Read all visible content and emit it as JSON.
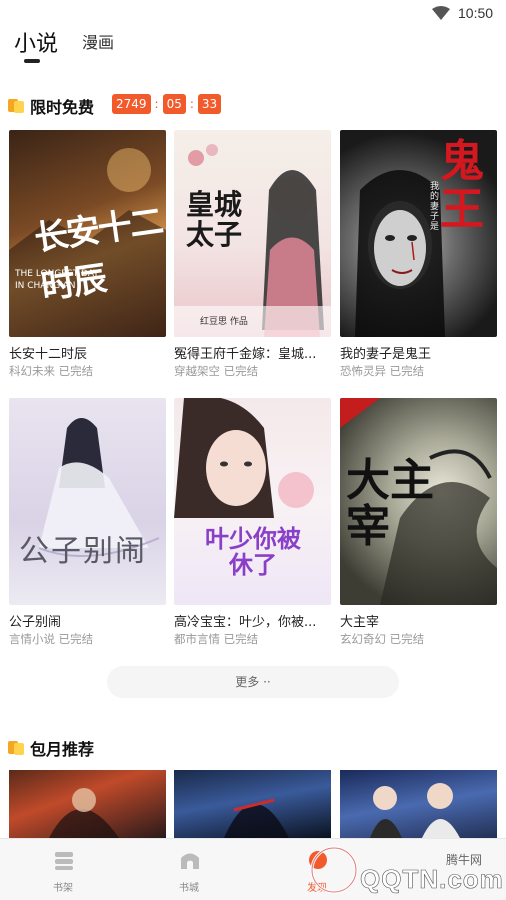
{
  "status_bar": {
    "time": "10:50"
  },
  "top_tabs": {
    "active": "小说",
    "inactive": "漫画"
  },
  "limited_free": {
    "title": "限时免费",
    "countdown": {
      "hours": "2749",
      "minutes": "05",
      "seconds": "33"
    },
    "books": [
      {
        "title": "长安十二时辰",
        "genre": "科幻未来",
        "status": "已完结",
        "cover_text": "长安十二时辰",
        "cover_sub": "THE LONGEST DAY IN CHANG'AN"
      },
      {
        "title": "冤得王府千金嫁：皇城...",
        "genre": "穿越架空",
        "status": "已完结",
        "cover_text": "皇城太子",
        "cover_sub": "红豆思 作品"
      },
      {
        "title": "我的妻子是鬼王",
        "genre": "恐怖灵异",
        "status": "已完结",
        "cover_text": "鬼王",
        "cover_sub": "我的妻子是"
      },
      {
        "title": "公子别闹",
        "genre": "言情小说",
        "status": "已完结",
        "cover_text": "公子别闹",
        "cover_sub": ""
      },
      {
        "title": "高冷宝宝：叶少，你被...",
        "genre": "都市言情",
        "status": "已完结",
        "cover_text": "叶少你被休了",
        "cover_sub": ""
      },
      {
        "title": "大主宰",
        "genre": "玄幻奇幻",
        "status": "已完结",
        "cover_text": "大主宰",
        "cover_sub": ""
      }
    ],
    "more_label": "更多 ··"
  },
  "monthly": {
    "title": "包月推荐"
  },
  "bottom_nav": [
    {
      "label": "书架",
      "icon": "bookshelf-icon"
    },
    {
      "label": "书城",
      "icon": "bookstore-icon"
    },
    {
      "label": "发现",
      "icon": "discover-icon"
    }
  ],
  "watermark": {
    "text": "QQTN.com",
    "sub": "腾牛网"
  },
  "colors": {
    "accent": "#f25a2b",
    "section_icon": "#f5a623"
  }
}
